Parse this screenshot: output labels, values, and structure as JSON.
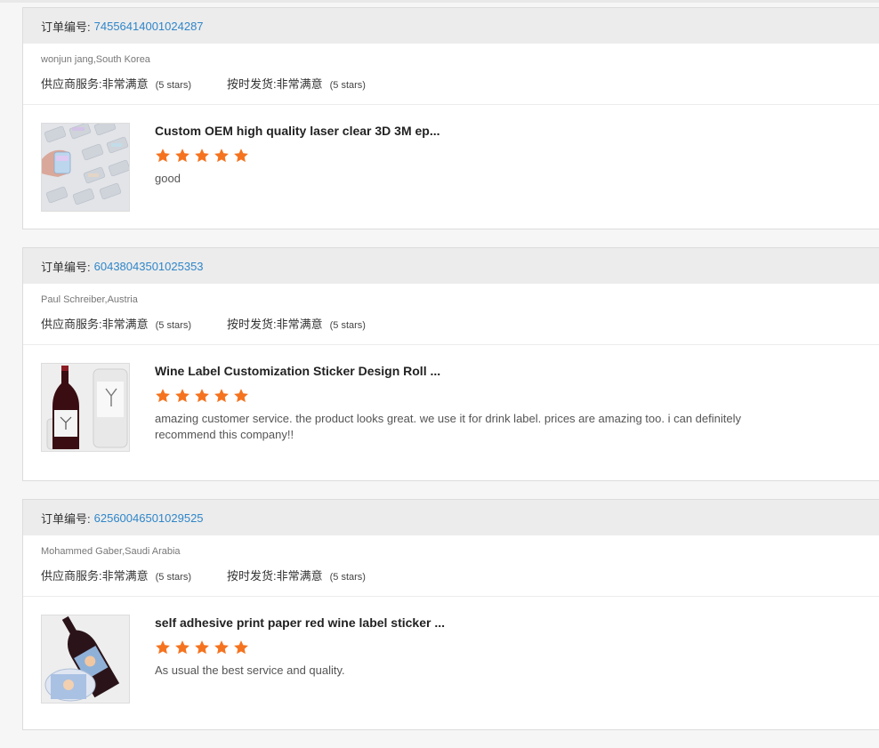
{
  "order_label": "订单编号:",
  "star_color": "#f5731f",
  "reviews": [
    {
      "order_number": "74556414001024287",
      "buyer": "wonjun jang,South Korea",
      "supplier_service_label": "供应商服务:",
      "supplier_service_value": "非常满意",
      "supplier_service_stars": "(5 stars)",
      "ontime_label": "按时发货:",
      "ontime_value": "非常满意",
      "ontime_stars": "(5 stars)",
      "product_title": "Custom OEM high quality laser clear 3D 3M ep...",
      "rating": 5,
      "comment": "good"
    },
    {
      "order_number": "60438043501025353",
      "buyer": "Paul Schreiber,Austria",
      "supplier_service_label": "供应商服务:",
      "supplier_service_value": "非常满意",
      "supplier_service_stars": "(5 stars)",
      "ontime_label": "按时发货:",
      "ontime_value": "非常满意",
      "ontime_stars": "(5 stars)",
      "product_title": "Wine Label Customization Sticker Design Roll ...",
      "rating": 5,
      "comment": "amazing customer service. the product looks great. we use it for drink label. prices are amazing too. i can definitely recommend this company!!"
    },
    {
      "order_number": "62560046501029525",
      "buyer": "Mohammed Gaber,Saudi Arabia",
      "supplier_service_label": "供应商服务:",
      "supplier_service_value": "非常满意",
      "supplier_service_stars": "(5 stars)",
      "ontime_label": "按时发货:",
      "ontime_value": "非常满意",
      "ontime_stars": "(5 stars)",
      "product_title": "self adhesive print paper red wine label sticker ...",
      "rating": 5,
      "comment": "As usual the best service and quality."
    }
  ]
}
